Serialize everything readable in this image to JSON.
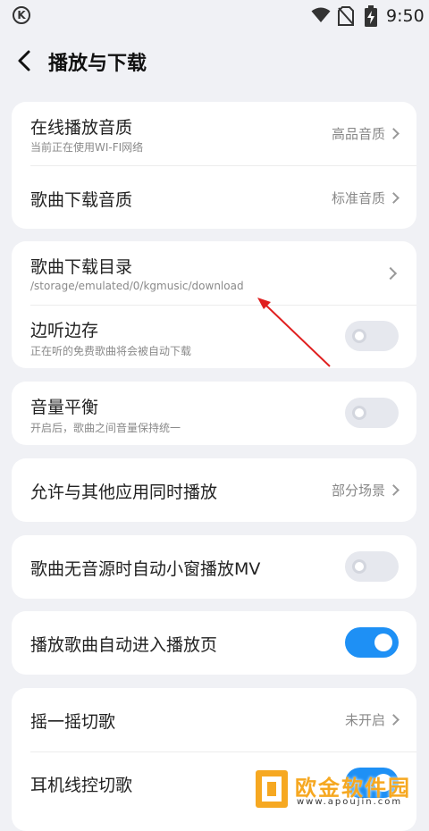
{
  "status_bar": {
    "k_letter": "K",
    "time": "9:50"
  },
  "header": {
    "title": "播放与下载"
  },
  "settings": {
    "online_quality": {
      "title": "在线播放音质",
      "subtitle": "当前正在使用WI-FI网络",
      "value": "高品音质"
    },
    "download_quality": {
      "title": "歌曲下载音质",
      "value": "标准音质"
    },
    "download_dir": {
      "title": "歌曲下载目录",
      "subtitle": "/storage/emulated/0/kgmusic/download"
    },
    "listen_save": {
      "title": "边听边存",
      "subtitle": "正在听的免费歌曲将会被自动下载",
      "enabled": false
    },
    "volume_balance": {
      "title": "音量平衡",
      "subtitle": "开启后，歌曲之间音量保持统一",
      "enabled": false
    },
    "allow_simultaneous": {
      "title": "允许与其他应用同时播放",
      "value": "部分场景"
    },
    "auto_mv": {
      "title": "歌曲无音源时自动小窗播放MV",
      "enabled": false
    },
    "auto_play_page": {
      "title": "播放歌曲自动进入播放页",
      "enabled": true
    },
    "shake_switch": {
      "title": "摇一摇切歌",
      "value": "未开启"
    },
    "headset_control": {
      "title": "耳机线控切歌",
      "enabled": true
    }
  },
  "colors": {
    "accent": "#1e90f5",
    "annotation_arrow": "#e02020",
    "watermark": "#f6a821"
  },
  "watermark": {
    "text": "欧金软件园",
    "sub": "www.apoujin.com"
  }
}
